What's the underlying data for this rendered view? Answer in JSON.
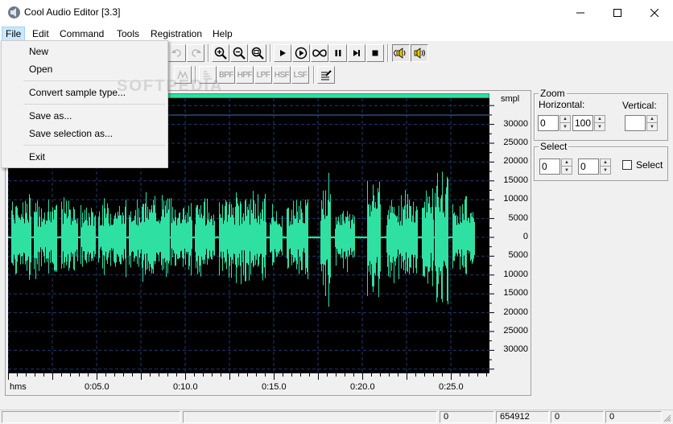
{
  "window": {
    "title": "Cool Audio Editor [3.3]",
    "icon": "speaker-app-icon"
  },
  "menu": [
    "File",
    "Edit",
    "Command",
    "Tools",
    "Registration",
    "Help"
  ],
  "file_menu": {
    "items": [
      "New",
      "Open",
      "Convert sample type...",
      "Save as...",
      "Save selection as...",
      "Exit"
    ]
  },
  "watermark": "SOFTPEDIA",
  "toolbar2": {
    "filters": [
      "BPF",
      "HPF",
      "LPF",
      "HSF",
      "LSF"
    ]
  },
  "waveform": {
    "unit": "smpl",
    "amp_labels": [
      "30000",
      "25000",
      "20000",
      "15000",
      "10000",
      "5000",
      "0",
      "5000",
      "10000",
      "15000",
      "20000",
      "25000",
      "30000"
    ],
    "time_unit": "hms",
    "time_labels": [
      "0:05.0",
      "0:10.0",
      "0:15.0",
      "0:20.0",
      "0:25.0"
    ],
    "wave_color": "#2fe0a3"
  },
  "zoom": {
    "title": "Zoom",
    "horizontal_label": "Horizontal:",
    "vertical_label": "Vertical:",
    "h_value1": "0",
    "h_value2": "100",
    "v_value": ""
  },
  "select": {
    "title": "Select",
    "start": "0",
    "end": "0",
    "checkbox_label": "Select"
  },
  "status": {
    "cells": [
      "",
      "",
      "0",
      "654912",
      "0",
      "0"
    ]
  }
}
